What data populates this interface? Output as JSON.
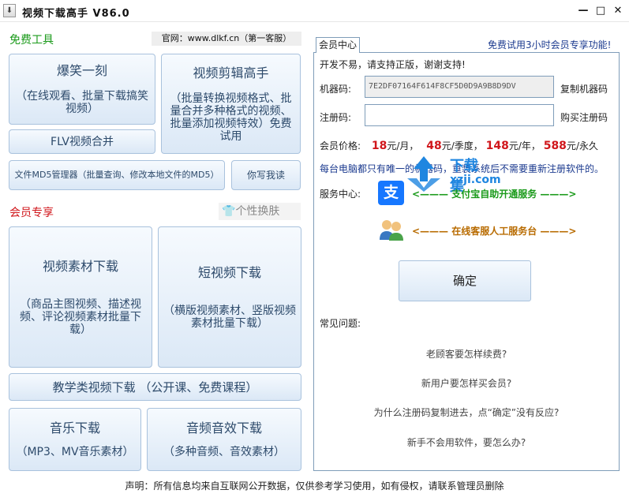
{
  "window": {
    "title": "视频下载高手 V86.0",
    "app_icon": "download-arrow-icon",
    "min_label": "—",
    "max_label": "□",
    "close_label": "✕"
  },
  "free": {
    "title": "免费工具",
    "site": "官网：www.dlkf.cn（第一客服）",
    "btn1": {
      "t1": "爆笑一刻",
      "t2": "（在线观看、批量下载搞笑视频）"
    },
    "btn2": {
      "t1": "视频剪辑高手",
      "t2": "（批量转换视频格式、批量合并多种格式的视频、批量添加视频特效）免费试用"
    },
    "btn3": {
      "t1": "FLV视频合并"
    },
    "btn4": {
      "t1": "文件MD5管理器（批量查询、修改本地文件的MD5）"
    },
    "btn5": {
      "t1": "你写我读"
    }
  },
  "member": {
    "title": "会员专享",
    "skin": "个性换肤",
    "btn1": {
      "t1": "视频素材下载",
      "t2": "（商品主图视频、描述视频、评论视频素材批量下载）"
    },
    "btn2": {
      "t1": "短视频下载",
      "t2": "（横版视频素材、竖版视频素材批量下载）"
    },
    "btn3": {
      "t1": "教学类视频下载 （公开课、免费课程）"
    },
    "btn4": {
      "t1": "音乐下载",
      "t2": "（MP3、MV音乐素材）"
    },
    "btn5": {
      "t1": "音频音效下载",
      "t2": "（多种音频、音效素材）"
    }
  },
  "center": {
    "tab": "会员中心",
    "trial": "免费试用3小时会员专享功能!",
    "support": "开发不易，请支持正版，谢谢支持!",
    "machine_label": "机器码:",
    "machine_code": "7E2DF07164F614F8CF5D0D9A9B8D9DV",
    "copy_machine": "复制机器码",
    "reg_label": "注册码:",
    "reg_value": "",
    "buy_reg": "购买注册码",
    "price_label": "会员价格:",
    "prices": [
      {
        "amount": "18",
        "unit": "元/月，"
      },
      {
        "amount": "48",
        "unit": "元/季度，"
      },
      {
        "amount": "148",
        "unit": "元/年，"
      },
      {
        "amount": "588",
        "unit": "元/永久"
      }
    ],
    "note": "每台电脑都只有唯一的机器码，重装系统后不需要重新注册软件的。",
    "service_label": "服务中心:",
    "alipay_icon": "alipay-icon",
    "alipay_text": "<——— 支付宝自助开通服务 ———>",
    "cs_icon": "customer-service-icon",
    "cs_text": "<——— 在线客服人工服务台 ———>",
    "confirm": "确定",
    "faq_label": "常见问题:",
    "faqs": [
      "老顾客要怎样续费?",
      "新用户要怎样买会员?",
      "为什么注册码复制进去，点“确定”没有反应?",
      "新手不会用软件，要怎么办?"
    ]
  },
  "footer": "声明：所有信息均来自互联网公开数据，仅供参考学习使用，如有侵权，请联系管理员删除",
  "watermark": {
    "line1": "下载集",
    "line2": "xzji.com"
  },
  "colors": {
    "green": "#1a9a1a",
    "red": "#d0161b",
    "blue": "#1b3a8f",
    "alipay": "#1677ff"
  }
}
